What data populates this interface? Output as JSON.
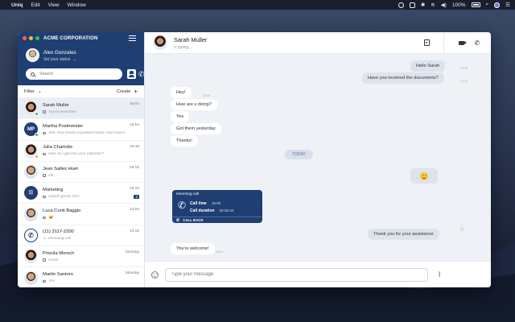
{
  "menubar": {
    "apple": "",
    "items": [
      "Uniq",
      "Edit",
      "View",
      "Window"
    ],
    "wifi": "≋",
    "battery": "100%",
    "search": "⌕"
  },
  "sidebar": {
    "org_name": "ACME CORPORATION",
    "user_name": "Alex Gonzales",
    "user_status": "Set your status",
    "search_placeholder": "Search",
    "filter_label": "Filter",
    "create_label": "Create",
    "conversations": [
      {
        "name": "Sarah Muller",
        "preview": "You're welcome!",
        "time": "16:04",
        "avatar": "photo-f",
        "status": "#3bb55c"
      },
      {
        "name": "Martha Postmeister",
        "preview": "Ahh, that seems expedited since I last read it",
        "time": "15:54",
        "avatar": "MP",
        "status": "#3bb55c"
      },
      {
        "name": "Julia Charlotte",
        "preview": "How do I get into your calendar?",
        "time": "15:48",
        "avatar": "photo-f",
        "status": "#f5a623"
      },
      {
        "name": "Jean Salles Huet",
        "preview": "Ok",
        "time": "15:15",
        "avatar": "photo",
        "status": ""
      },
      {
        "name": "Marketing",
        "preview": "Ooooh great! Yes!",
        "time": "15:10",
        "avatar": "group",
        "status": "",
        "badge": "3"
      },
      {
        "name": "Luca Conti Baggio",
        "preview": "😀",
        "time": "12:54",
        "avatar": "photo",
        "status": ""
      },
      {
        "name": "(11) 3117-2200",
        "preview": "Incoming call",
        "time": "12:15",
        "avatar": "call",
        "status": ""
      },
      {
        "name": "Priscila Morsch",
        "preview": "Great",
        "time": "Monday",
        "avatar": "photo-f",
        "status": ""
      },
      {
        "name": "Martin Santoro",
        "preview": "Yes",
        "time": "Monday",
        "avatar": "photo",
        "status": ""
      }
    ]
  },
  "chat": {
    "contact_name": "Sarah Muller",
    "typing": "is typing...",
    "today_label": "TODAY",
    "messages": {
      "out1": "Hello Sarah",
      "out1_time": "15:58",
      "out2": "Have you received the documents?",
      "out2_time": "15:59",
      "in1": "Hey!",
      "in1_time": "15:59",
      "in2": "How are u doing?",
      "in3": "Yes",
      "in4": "Got them yesterday",
      "in5": "Thanks!",
      "out3": "Thank you for your assistance",
      "in6": "You're welcome!",
      "in6_time": "16:04"
    },
    "call_card": {
      "title": "Incoming call",
      "time_label": "Call time",
      "time_value": "15:55",
      "duration_label": "Call duration",
      "duration_value": "00:06:33",
      "callback_label": "CALL BACK"
    },
    "composer_placeholder": "Type your message"
  },
  "colors": {
    "brand": "#1f3f73",
    "chat_bg": "#eef1f6",
    "bubble_out": "#dde3ec",
    "online": "#3bb55c",
    "away": "#f5a623"
  }
}
